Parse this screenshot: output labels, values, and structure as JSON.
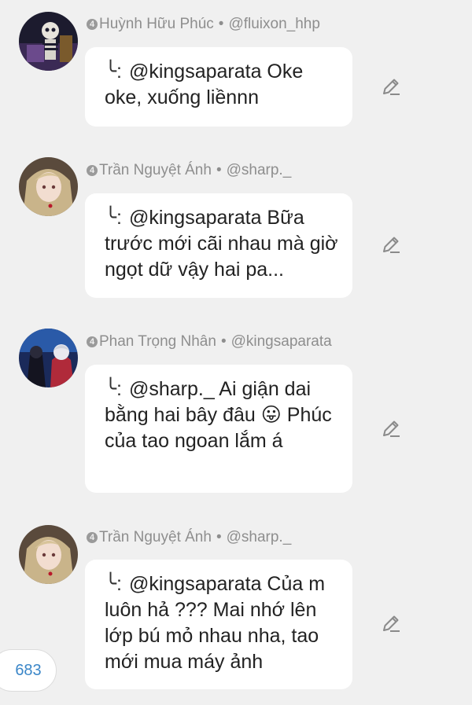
{
  "comments": [
    {
      "level": "4",
      "name": "Huỳnh Hữu Phúc",
      "separator": "•",
      "handle": "@fluixon_hhp",
      "reply_prefix": "╰:",
      "text": "@kingsaparata Oke oke, xuống liềnnn",
      "avatar_icon": "skeleton-avatar"
    },
    {
      "level": "4",
      "name": "Trần Nguyệt Ánh",
      "separator": "•",
      "handle": "@sharp._",
      "reply_prefix": "╰:",
      "text": "@kingsaparata Bữa trước mới cãi nhau mà giờ ngọt dữ vậy hai pa...",
      "avatar_icon": "anime-girl-avatar"
    },
    {
      "level": "4",
      "name": "Phan Trọng Nhân",
      "separator": "•",
      "handle": "@kingsaparata",
      "reply_prefix": "╰:",
      "text": "@sharp._ Ai giận dai bằng hai bây đâu 😛 Phúc của tao ngoan lắm á",
      "avatar_icon": "anime-couple-avatar"
    },
    {
      "level": "4",
      "name": "Trần Nguyệt Ánh",
      "separator": "•",
      "handle": "@sharp._",
      "reply_prefix": "╰:",
      "text": "@kingsaparata Của m luôn hả ??? Mai nhớ lên lớp bú mỏ nhau nha, tao mới mua máy ảnh",
      "avatar_icon": "anime-girl-avatar"
    }
  ],
  "counter": {
    "value": "683"
  },
  "colors": {
    "background": "#f0f0f0",
    "bubble": "#ffffff",
    "meta_text": "#8e8e8e",
    "counter_text": "#3a86c8"
  },
  "edit_icon": "pencil-icon"
}
